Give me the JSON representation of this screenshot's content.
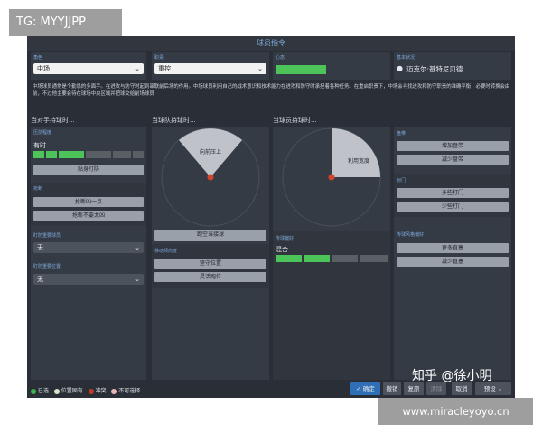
{
  "watermark_top": "TG: MYYJJPP",
  "watermark_zhihu": "知乎 @徐小明",
  "watermark_bottom": "www.miracleyoyo.cn",
  "dialog": {
    "title": "球员指令",
    "role": {
      "label": "角色",
      "value": "中场"
    },
    "duty": {
      "label": "职责",
      "value": "重控"
    },
    "fitness": {
      "label": "心态",
      "level": 1.0
    },
    "player": {
      "label": "基本状况",
      "name": "迈克尔·基特尼贝德"
    },
    "description": "中场球员通常是个勤恳的多面手。在进攻与防守时起到串联前后场的作用。中场球员利用自己的战术意识和技术能力在进攻和防守时承担着各种任务。在重启职责下，中场会寻找进攻和防守职责的准确平衡，必要时转换会由前，不过他主要会待在球场中央区域并把球交给前场球员"
  },
  "sections": {
    "opp_ball": {
      "title": "当对手持球时...",
      "pressing": {
        "label": "压前程度",
        "value": "有时",
        "segments_filled": 3,
        "segments_total": 6
      },
      "mark_button": "贴身盯防",
      "tackle": {
        "label": "抢断",
        "btn1": "抢断凶一点",
        "btn2": "抢断不要太凶"
      },
      "mark_target": {
        "label": "盯防重要球员",
        "value": "无"
      },
      "mark_position": {
        "label": "盯防重要位置",
        "value": "无"
      }
    },
    "team_ball": {
      "title": "当球队持球时...",
      "zone_label": "向前压上",
      "go_button": "跑空当接球",
      "movement": {
        "label": "移动倾向度",
        "btn1": "坚守位置",
        "btn2": "灵活跑位"
      }
    },
    "player_ball": {
      "title": "当球员持球时...",
      "zone_label": "利用宽度",
      "passing": {
        "label": "传球偏好",
        "value": "混合",
        "segments_filled": 2,
        "segments_total": 4
      }
    },
    "right": {
      "dribble": {
        "label": "盘带",
        "btn1": "增加盘带",
        "btn2": "减少盘带"
      },
      "shoot": {
        "label": "射门",
        "btn1": "多些打门",
        "btn2": "少些打门"
      },
      "cross": {
        "label": "传球风格偏好",
        "btn1": "更多直塞",
        "btn2": "减少直塞"
      }
    }
  },
  "legend": [
    {
      "label": "已选",
      "color": "#3fb24a"
    },
    {
      "label": "位置固有",
      "color": "#d6e6c6"
    },
    {
      "label": "冲突",
      "color": "#c0392b"
    },
    {
      "label": "不可选择",
      "color": "#e9b7b7"
    }
  ],
  "footer": {
    "confirm": "确定",
    "undo": "撤销",
    "reset": "复原",
    "clear": "清除",
    "cancel": "取消",
    "preset": "预设"
  },
  "colors": {
    "selected_green": "#4cc45a",
    "empty_seg": "#5a5f66",
    "accent_blue": "#2e6fb6"
  }
}
